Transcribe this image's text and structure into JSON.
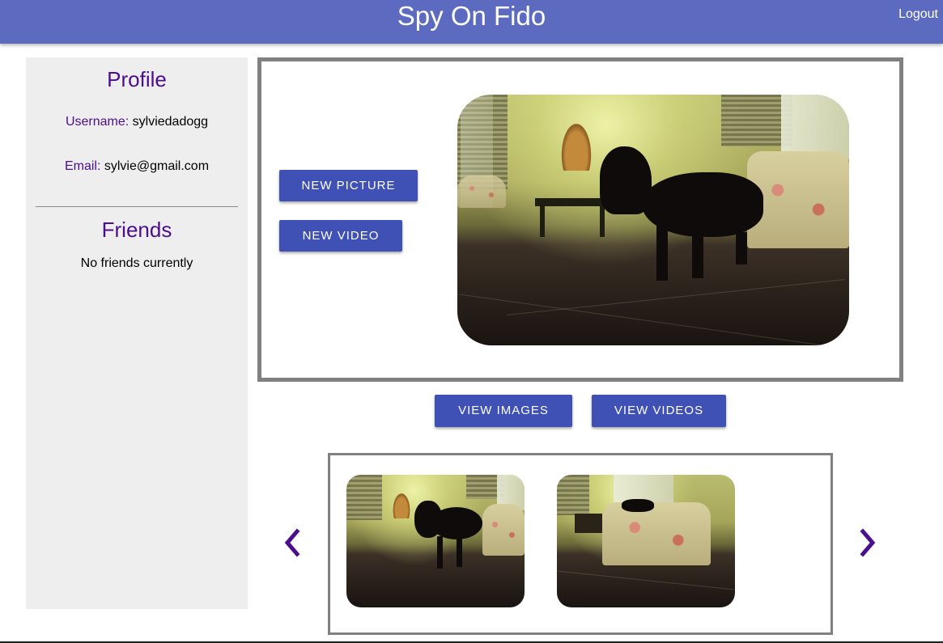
{
  "header": {
    "title": "Spy On Fido",
    "logout_label": "Logout"
  },
  "profile": {
    "heading": "Profile",
    "username_label": "Username:",
    "username_value": "sylviedadogg",
    "email_label": "Email:",
    "email_value": "sylvie@gmail.com"
  },
  "friends": {
    "heading": "Friends",
    "empty_text": "No friends currently"
  },
  "capture": {
    "new_picture_label": "NEW PICTURE",
    "new_video_label": "NEW VIDEO"
  },
  "media_view": {
    "view_images_label": "VIEW IMAGES",
    "view_videos_label": "VIEW VIDEOS"
  },
  "gallery": {
    "prev_icon": "chevron-left-icon",
    "next_icon": "chevron-right-icon"
  },
  "colors": {
    "appbar": "#5c6bc0",
    "button": "#3f51b5",
    "accent_text": "#4a0e8f",
    "sidebar_bg": "#eeeeee",
    "panel_border": "#808080"
  }
}
